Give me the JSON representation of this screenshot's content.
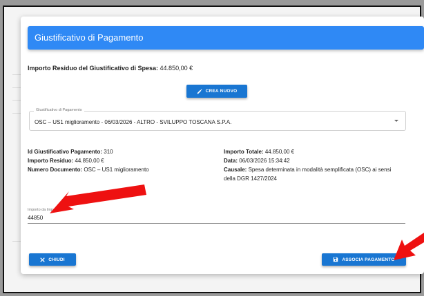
{
  "dialog": {
    "title": "Giustificativo di Pagamento",
    "residuo_label": "Importo Residuo del Giustificativo di Spesa:",
    "residuo_value": "44.850,00 €"
  },
  "buttons": {
    "crea_nuovo": "CREA NUOVO",
    "chiudi": "CHIUDI",
    "associa": "ASSOCIA PAGAMENTO"
  },
  "select": {
    "legend": "Giustificativo di Pagamento",
    "value": "OSC – US1 miglioramento - 06/03/2026 - ALTRO - SVILUPPO TOSCANA S.P.A."
  },
  "details": {
    "id_label": "Id Giustificativo Pagamento:",
    "id_value": "310",
    "residuo_label": "Importo Residuo:",
    "residuo_value": "44.850,00 €",
    "numero_label": "Numero Documento:",
    "numero_value": "OSC – US1 miglioramento",
    "totale_label": "Importo Totale:",
    "totale_value": "44.850,00 €",
    "data_label": "Data:",
    "data_value": "06/03/2026 15:34:42",
    "causale_label": "Causale:",
    "causale_line1": "Spesa determinata in modalità semplificata (OSC) ai sensi",
    "causale_line2": "della DGR 1427/2024"
  },
  "importo": {
    "label": "Importo da Imputar",
    "value": "44850"
  },
  "colors": {
    "header": "#2f89f5",
    "button": "#1976d2",
    "arrow": "#ee1111"
  }
}
